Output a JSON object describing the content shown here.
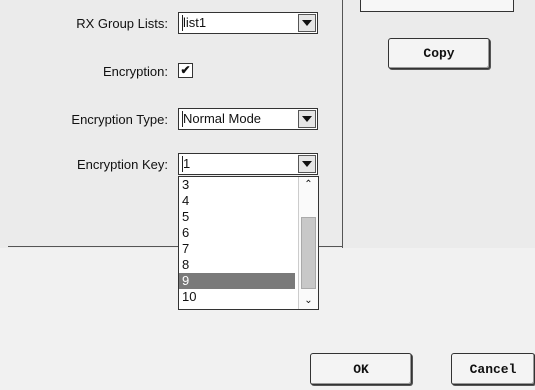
{
  "form": {
    "rx_group_label": "RX Group Lists:",
    "rx_group_value": "list1",
    "encryption_label": "Encryption:",
    "encryption_checked": "✔",
    "encryption_type_label": "Encryption Type:",
    "encryption_type_value": "Normal Mode",
    "encryption_key_label": "Encryption Key:",
    "encryption_key_value": "1"
  },
  "dropdown": {
    "items": [
      "3",
      "4",
      "5",
      "6",
      "7",
      "8",
      "9",
      "10"
    ],
    "selected": "9"
  },
  "buttons": {
    "copy": "Copy",
    "ok": "OK",
    "cancel": "Cancel"
  }
}
